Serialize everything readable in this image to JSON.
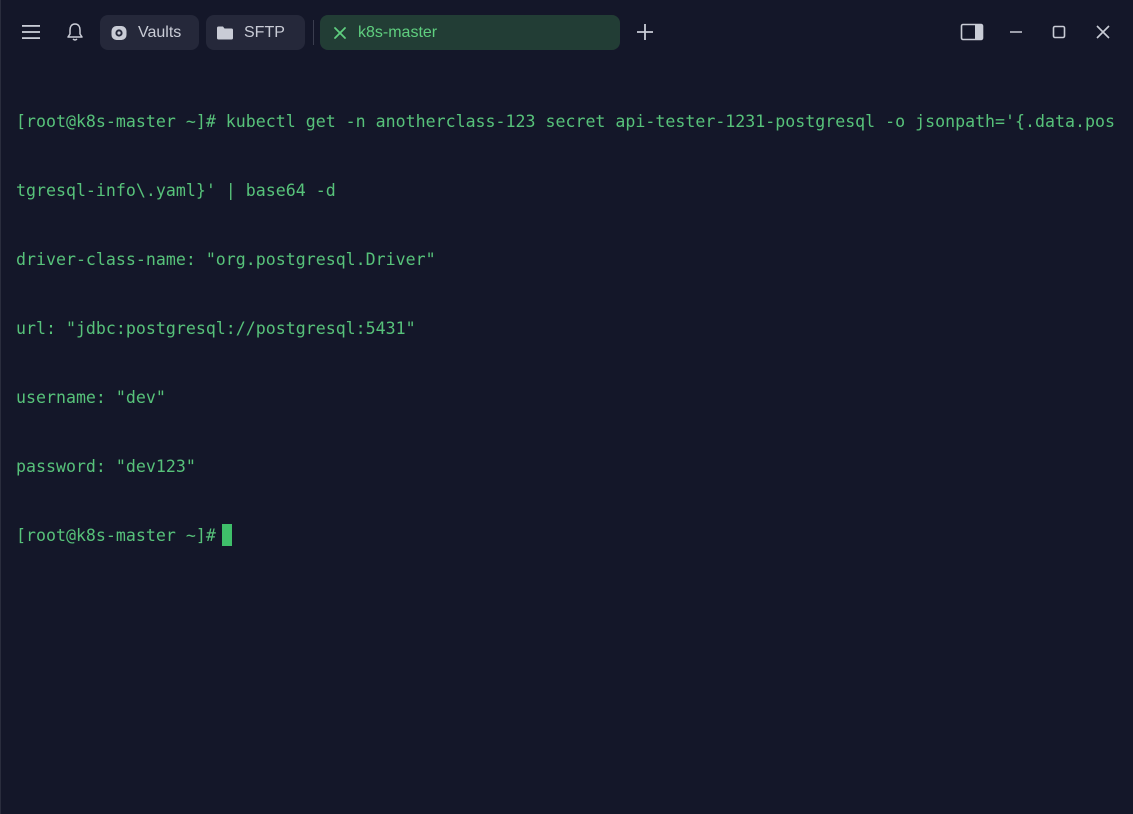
{
  "toolbar": {
    "menu_icon": "hamburger-menu-icon",
    "notifications_icon": "bell-icon",
    "new_tab_icon": "plus-icon"
  },
  "tabs": [
    {
      "label": "Vaults",
      "icon": "vault-icon",
      "active": false
    },
    {
      "label": "SFTP",
      "icon": "folder-icon",
      "active": false
    },
    {
      "label": "k8s-master",
      "icon": "close-x-icon",
      "active": true
    }
  ],
  "window_controls": {
    "sidebar_icon": "toggle-sidebar-icon",
    "minimize_icon": "minimize-icon",
    "maximize_icon": "maximize-icon",
    "close_icon": "close-icon"
  },
  "colors": {
    "background": "#141729",
    "terminal_text": "#57c27a",
    "active_tab_bg": "#223d35",
    "active_tab_text": "#5fcf7f",
    "cursor": "#3fbf6a"
  },
  "terminal": {
    "lines": [
      "[root@k8s-master ~]# kubectl get -n anotherclass-123 secret api-tester-1231-postgresql -o jsonpath='{.data.pos",
      "tgresql-info\\.yaml}' | base64 -d",
      "driver-class-name: \"org.postgresql.Driver\"",
      "url: \"jdbc:postgresql://postgresql:5431\"",
      "username: \"dev\"",
      "password: \"dev123\""
    ],
    "prompt": "[root@k8s-master ~]#"
  }
}
